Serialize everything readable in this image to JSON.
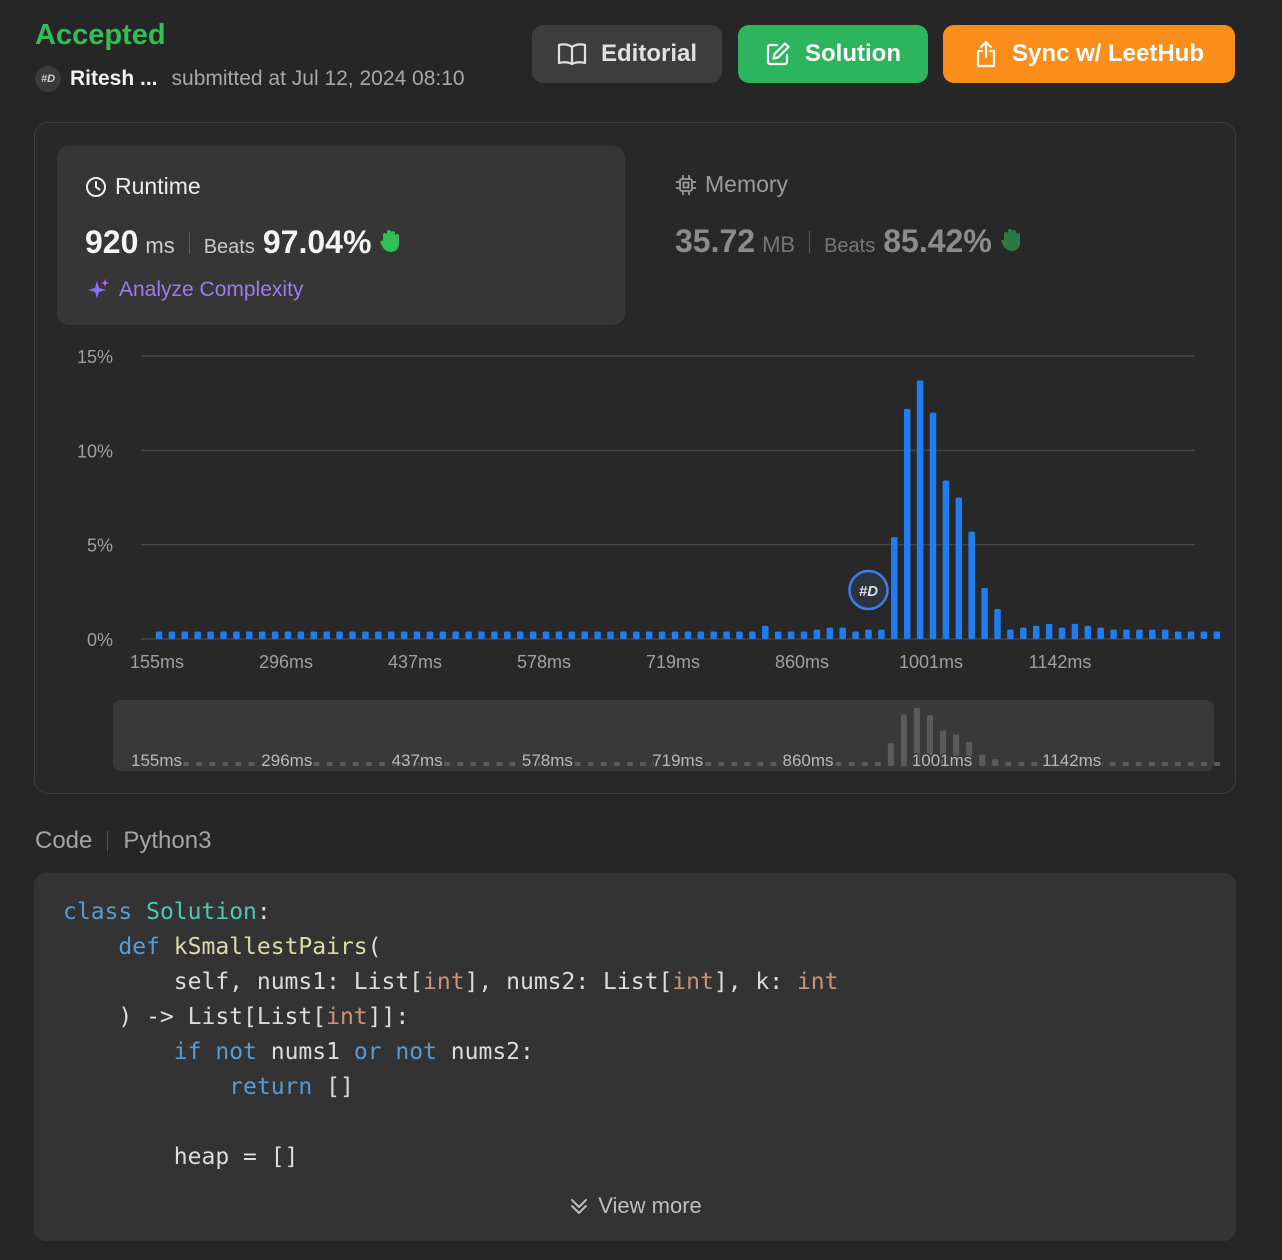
{
  "header": {
    "status": "Accepted",
    "avatar_text": "#D",
    "user_name": "Ritesh ...",
    "submitted": "submitted at Jul 12, 2024 08:10",
    "buttons": {
      "editorial": "Editorial",
      "solution": "Solution",
      "sync": "Sync w/ LeetHub"
    }
  },
  "runtime": {
    "title": "Runtime",
    "value": "920",
    "unit": "ms",
    "beats_label": "Beats",
    "beats": "97.04%",
    "analyze": "Analyze Complexity"
  },
  "memory": {
    "title": "Memory",
    "value": "35.72",
    "unit": "MB",
    "beats_label": "Beats",
    "beats": "85.42%"
  },
  "chart_data": {
    "type": "bar",
    "ylim": [
      0,
      15
    ],
    "yticks": [
      "0%",
      "5%",
      "10%",
      "15%"
    ],
    "ytick_values": [
      0,
      5,
      10,
      15
    ],
    "xticks": [
      "155ms",
      "296ms",
      "437ms",
      "578ms",
      "719ms",
      "860ms",
      "1001ms",
      "1142ms"
    ],
    "marker_index": 55,
    "values": [
      0.4,
      0.4,
      0.4,
      0.4,
      0.4,
      0.4,
      0.4,
      0.4,
      0.4,
      0.4,
      0.4,
      0.4,
      0.4,
      0.4,
      0.4,
      0.4,
      0.4,
      0.4,
      0.4,
      0.4,
      0.4,
      0.4,
      0.4,
      0.4,
      0.4,
      0.4,
      0.4,
      0.4,
      0.4,
      0.4,
      0.4,
      0.4,
      0.4,
      0.4,
      0.4,
      0.4,
      0.4,
      0.4,
      0.4,
      0.4,
      0.4,
      0.4,
      0.4,
      0.4,
      0.4,
      0.4,
      0.4,
      0.7,
      0.4,
      0.4,
      0.4,
      0.5,
      0.6,
      0.6,
      0.4,
      0.5,
      0.5,
      5.4,
      12.2,
      13.7,
      12.0,
      8.4,
      7.5,
      5.7,
      2.7,
      1.6,
      0.5,
      0.6,
      0.7,
      0.8,
      0.6,
      0.8,
      0.7,
      0.6,
      0.5,
      0.5,
      0.5,
      0.5,
      0.5,
      0.4,
      0.4,
      0.4,
      0.4
    ]
  },
  "code": {
    "label": "Code",
    "language": "Python3",
    "view_more": "View more"
  }
}
